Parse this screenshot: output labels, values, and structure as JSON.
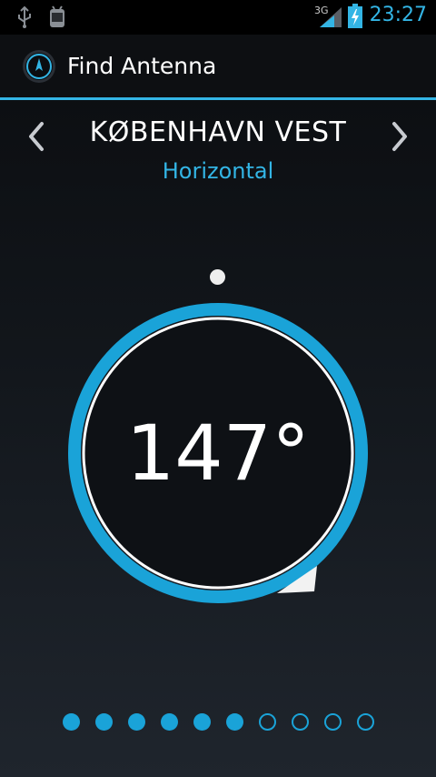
{
  "status_bar": {
    "time": "23:27",
    "network": "3G",
    "icons": [
      "usb-icon",
      "android-debug-icon",
      "signal-icon",
      "battery-charging-icon"
    ]
  },
  "action_bar": {
    "title": "Find Antenna",
    "app_icon": "antenna-compass-icon"
  },
  "station": {
    "name": "KØBENHAVN VEST",
    "polarization": "Horizontal",
    "prev_icon": "chevron-left-icon",
    "next_icon": "chevron-right-icon"
  },
  "compass": {
    "bearing": "147°",
    "bearing_value": 147,
    "ring_color": "#1aa3d8"
  },
  "pager": {
    "total": 10,
    "filled": 6,
    "color": "#1aa3d8"
  },
  "colors": {
    "accent": "#33b5e5",
    "ring": "#1aa3d8"
  }
}
